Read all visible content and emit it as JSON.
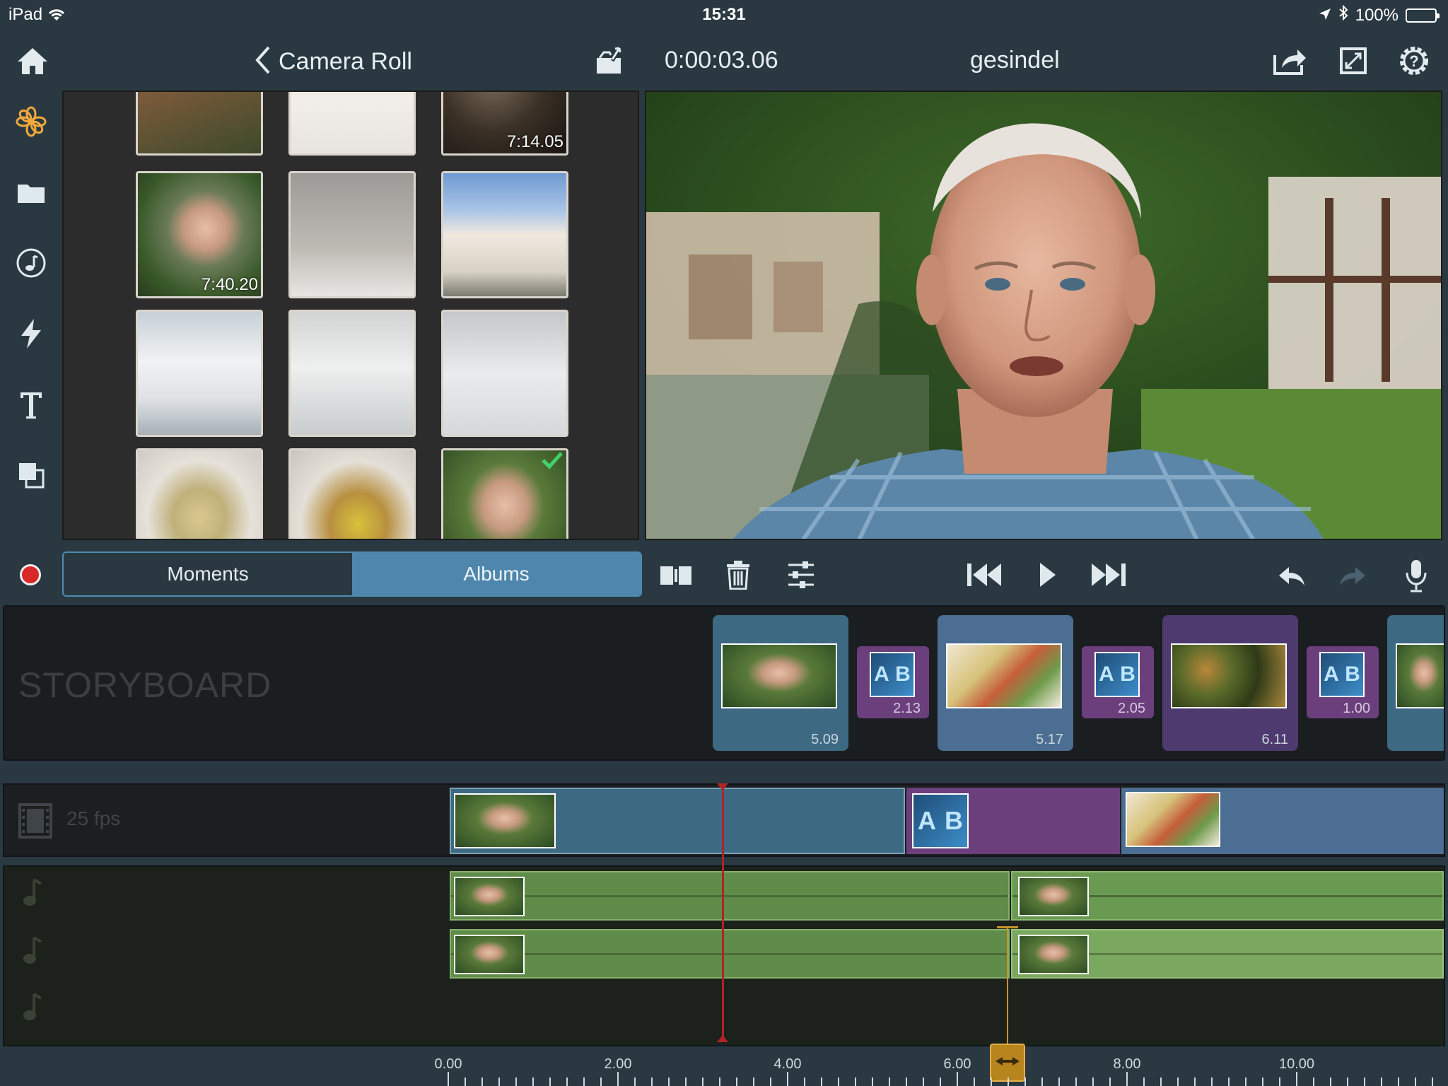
{
  "status_bar": {
    "device": "iPad",
    "time": "15:31",
    "battery": "100%"
  },
  "header": {
    "back_label": "Camera Roll",
    "timecode": "0:00:03.06",
    "project_title": "gesindel"
  },
  "media_browser": {
    "durations": [
      "7:14.05",
      "7:40.20"
    ],
    "tabs": [
      "Moments",
      "Albums"
    ],
    "selected_tab": "Albums"
  },
  "storyboard": {
    "label": "STORYBOARD",
    "clips": [
      "5.09",
      "5.17",
      "6.11"
    ],
    "transitions": [
      "2.13",
      "2.05",
      "1.00"
    ],
    "transition_glyph": "AB"
  },
  "timeline": {
    "fps_label": "25 fps",
    "ruler_labels": [
      "0.00",
      "2.00",
      "4.00",
      "6.00",
      "8.00",
      "10.00"
    ]
  },
  "colors": {
    "background": "#2a3941",
    "accent_blue": "#4e86ad",
    "transition_purple": "#6b3f7c",
    "audio_green": "#6a9a52",
    "playhead_red": "#b02424",
    "marker_gold": "#c9922a"
  }
}
